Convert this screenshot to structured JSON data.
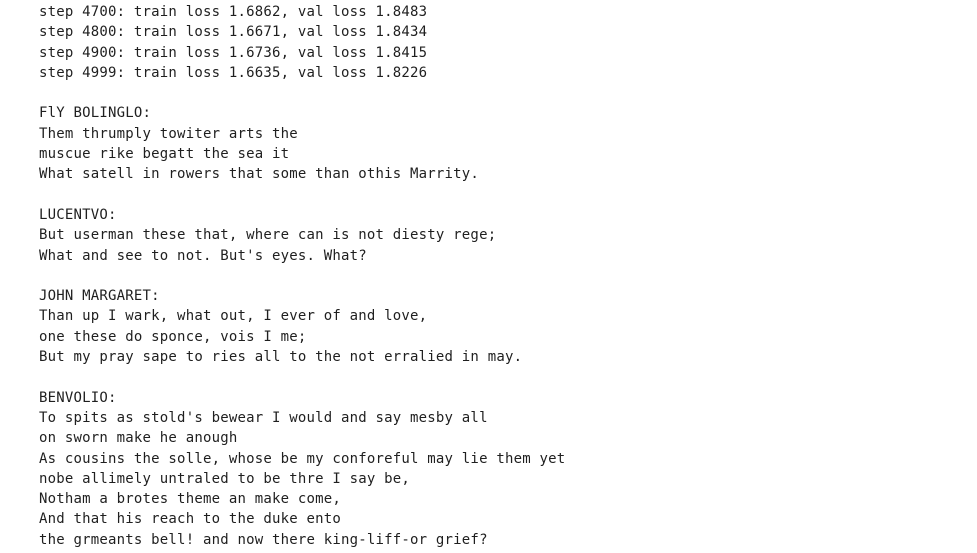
{
  "output": {
    "text": "step 4700: train loss 1.6862, val loss 1.8483\nstep 4800: train loss 1.6671, val loss 1.8434\nstep 4900: train loss 1.6736, val loss 1.8415\nstep 4999: train loss 1.6635, val loss 1.8226\n\nFlY BOLINGLO:\nThem thrumply towiter arts the\nmuscue rike begatt the sea it\nWhat satell in rowers that some than othis Marrity.\n\nLUCENTVO:\nBut userman these that, where can is not diesty rege;\nWhat and see to not. But's eyes. What?\n\nJOHN MARGARET:\nThan up I wark, what out, I ever of and love,\none these do sponce, vois I me;\nBut my pray sape to ries all to the not erralied in may.\n\nBENVOLIO:\nTo spits as stold's bewear I would and say mesby all\non sworn make he anough\nAs cousins the solle, whose be my conforeful may lie them yet\nnobe allimely untraled to be thre I say be,\nNotham a brotes theme an make come,\nAnd that his reach to the duke ento\nthe grmeants bell! and now there king-liff-or grief?"
  }
}
